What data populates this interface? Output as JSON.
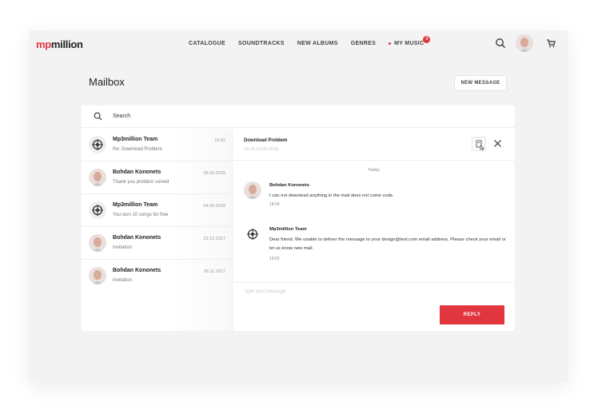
{
  "brand": {
    "logo_red": "mp",
    "logo_dark": "million",
    "accent": "#e2363e"
  },
  "nav": {
    "items": [
      "CATALOGUE",
      "SOUNDTRACKS",
      "NEW ALBUMS",
      "GENRES"
    ],
    "my_music": "MY MUSIC",
    "my_music_badge": "3"
  },
  "header_icons": [
    "search-icon",
    "avatar",
    "cart-icon"
  ],
  "page": {
    "title": "Mailbox",
    "new_message": "NEW MESSAGE"
  },
  "search": {
    "label": "Search"
  },
  "conversations": [
    {
      "name": "Mp3million Team",
      "subject": "Re: Download Problem",
      "date": "19:02",
      "avatar": "logo"
    },
    {
      "name": "Bohdan Kononets",
      "subject": "Thank you problem solved",
      "date": "09.09.2018",
      "avatar": "person"
    },
    {
      "name": "Mp3million Team",
      "subject": "You won 10 songs for free",
      "date": "04.09.2018",
      "avatar": "logo"
    },
    {
      "name": "Bohdan Kononets",
      "subject": "Invitation",
      "date": "23.12.2017",
      "avatar": "person"
    },
    {
      "name": "Bohdan Kononets",
      "subject": "Invitation",
      "date": "06.11.2017",
      "avatar": "person"
    }
  ],
  "thread": {
    "title": "Download Problem",
    "time": "18:24 10.09.2018",
    "day_label": "Today",
    "messages": [
      {
        "name": "Bohdan Kononets",
        "text": "I can not download anything in the mail does not come code.",
        "time": "18:24"
      },
      {
        "name": "Mp3million Team",
        "text": "Dear friend. We unable to deliver the message to your design@test.com email address. Please check your email or let us know new mail.",
        "time": "19:02"
      }
    ]
  },
  "reply": {
    "placeholder": "Type your message",
    "button": "REPLY"
  }
}
